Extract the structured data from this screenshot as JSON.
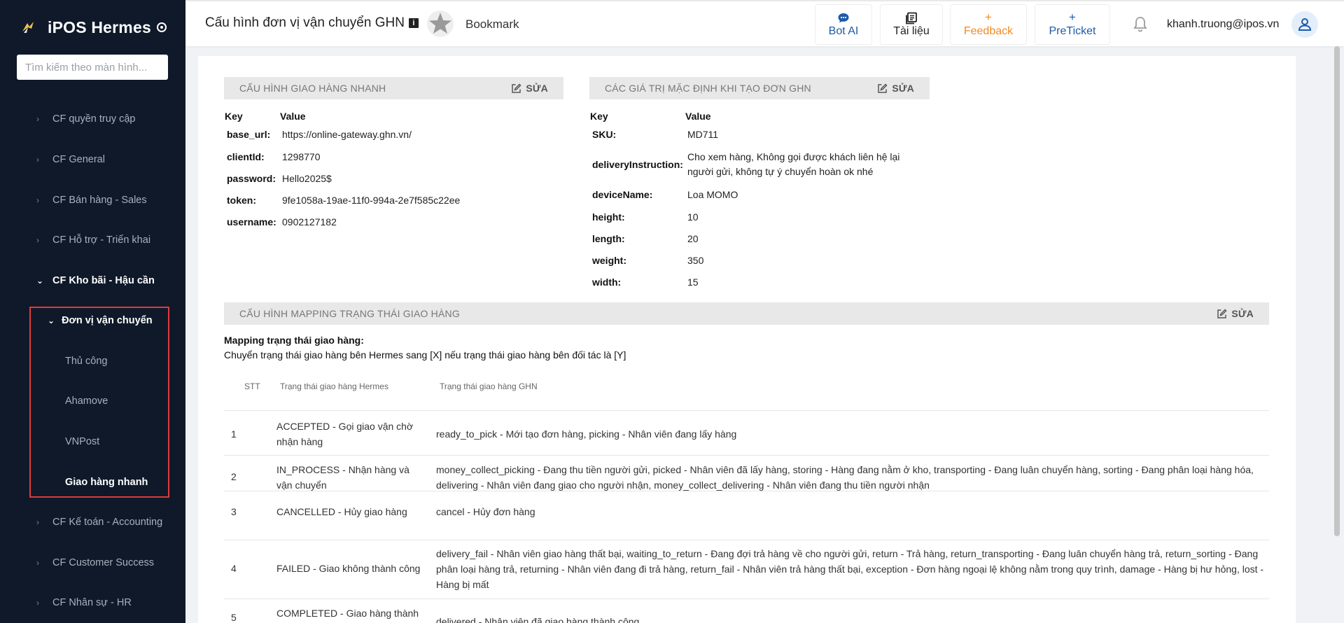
{
  "sidebar": {
    "brand": "iPOS Hermes",
    "search_placeholder": "Tìm kiếm theo màn hình...",
    "items": [
      {
        "label": "CF quyền truy cập"
      },
      {
        "label": "CF General"
      },
      {
        "label": "CF Bán hàng - Sales"
      },
      {
        "label": "CF Hỗ trợ - Triển khai"
      },
      {
        "label": "CF Kho bãi - Hậu cần"
      },
      {
        "label": "CF Kế toán - Accounting"
      },
      {
        "label": "CF Customer Success"
      },
      {
        "label": "CF Nhân sự - HR"
      }
    ],
    "submenu": {
      "head": "Đơn vị vận chuyển",
      "items": [
        {
          "label": "Thủ công"
        },
        {
          "label": "Ahamove"
        },
        {
          "label": "VNPost"
        },
        {
          "label": "Giao hàng nhanh"
        }
      ]
    }
  },
  "header": {
    "title": "Cấu hình đơn vị vận chuyển GHN",
    "info_glyph": "i",
    "bookmark": "Bookmark",
    "buttons": {
      "bot": "Bot AI",
      "docs": "Tài liệu",
      "feedback": "Feedback",
      "preticket": "PreTicket"
    },
    "user_email": "khanh.truong@ipos.vn"
  },
  "ghn_config": {
    "title": "CẤU HÌNH GIAO HÀNG NHANH",
    "edit": "SỬA",
    "key_header": "Key",
    "value_header": "Value",
    "rows": [
      {
        "key": "base_url:",
        "value": "https://online-gateway.ghn.vn/"
      },
      {
        "key": "clientId:",
        "value": "1298770"
      },
      {
        "key": "password:",
        "value": "Hello2025$"
      },
      {
        "key": "token:",
        "value": "9fe1058a-19ae-11f0-994a-2e7f585c22ee"
      },
      {
        "key": "username:",
        "value": "0902127182"
      }
    ]
  },
  "defaults": {
    "title": "CÁC GIÁ TRỊ MẶC ĐỊNH KHI TẠO ĐƠN GHN",
    "edit": "SỬA",
    "key_header": "Key",
    "value_header": "Value",
    "rows": [
      {
        "key": "SKU:",
        "value": "MD711"
      },
      {
        "key": "deliveryInstruction:",
        "value": "Cho xem hàng, Không gọi được khách liên hệ lại người gửi, không tự ý chuyển hoàn ok nhé"
      },
      {
        "key": "deviceName:",
        "value": "Loa MOMO"
      },
      {
        "key": "height:",
        "value": "10"
      },
      {
        "key": "length:",
        "value": "20"
      },
      {
        "key": "weight:",
        "value": "350"
      },
      {
        "key": "width:",
        "value": "15"
      }
    ]
  },
  "mapping": {
    "title": "CẤU HÌNH MAPPING TRẠNG THÁI GIAO HÀNG",
    "edit": "SỬA",
    "subtitle": "Mapping trạng thái giao hàng:",
    "description": "Chuyển trạng thái giao hàng bên Hermes sang [X] nếu trạng thái giao hàng bên đối tác là [Y]",
    "columns": [
      "STT",
      "Trạng thái giao hàng Hermes",
      "Trạng thái giao hàng GHN"
    ],
    "rows": [
      {
        "stt": "1",
        "hermes": "ACCEPTED - Gọi giao vận chờ nhận hàng",
        "ghn": "ready_to_pick - Mới tạo đơn hàng, picking - Nhân viên đang lấy hàng"
      },
      {
        "stt": "2",
        "hermes": "IN_PROCESS - Nhận hàng và vận chuyển",
        "ghn": "money_collect_picking - Đang thu tiền người gửi, picked - Nhân viên đã lấy hàng, storing - Hàng đang nằm ở kho, transporting - Đang luân chuyển hàng, sorting - Đang phân loại hàng hóa, delivering - Nhân viên đang giao cho người nhận, money_collect_delivering - Nhân viên đang thu tiền người nhận"
      },
      {
        "stt": "3",
        "hermes": "CANCELLED - Hủy giao hàng",
        "ghn": "cancel - Hủy đơn hàng"
      },
      {
        "stt": "4",
        "hermes": "FAILED - Giao không thành công",
        "ghn": "delivery_fail - Nhân viên giao hàng thất bại, waiting_to_return - Đang đợi trả hàng về cho người gửi, return - Trả hàng, return_transporting - Đang luân chuyển hàng trả, return_sorting - Đang phân loại hàng trả, returning - Nhân viên đang đi trả hàng, return_fail - Nhân viên trả hàng thất bại, exception - Đơn hàng ngoại lệ không nằm trong quy trình, damage - Hàng bị hư hỏng, lost - Hàng bị mất"
      },
      {
        "stt": "5",
        "hermes": "COMPLETED - Giao hàng thành công",
        "ghn": "delivered - Nhân viên đã giao hàng thành công"
      }
    ]
  }
}
